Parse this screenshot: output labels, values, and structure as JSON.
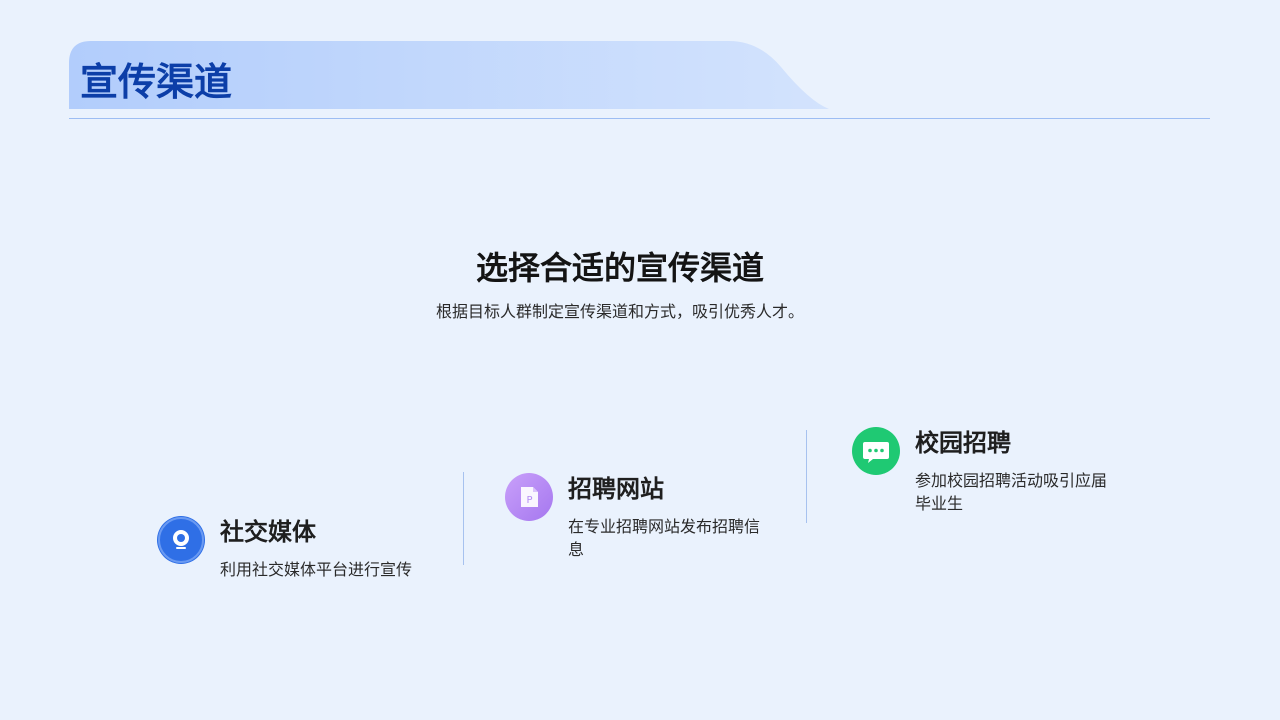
{
  "header": {
    "title": "宣传渠道"
  },
  "section": {
    "heading": "选择合适的宣传渠道",
    "subtitle": "根据目标人群制定宣传渠道和方式，吸引优秀人才。"
  },
  "channels": [
    {
      "title": "社交媒体",
      "description": "利用社交媒体平台进行宣传",
      "icon": "webcam-icon",
      "color": "#2f6fe6"
    },
    {
      "title": "招聘网站",
      "description": "在专业招聘网站发布招聘信息",
      "icon": "document-p-icon",
      "color": "#b48cf4"
    },
    {
      "title": "校园招聘",
      "description": "参加校园招聘活动吸引应届毕业生",
      "icon": "chat-bubble-icon",
      "color": "#1fc973"
    }
  ],
  "colors": {
    "background": "#eaf2fd",
    "title": "#0c3ea8",
    "rule": "#9dbdf3"
  }
}
